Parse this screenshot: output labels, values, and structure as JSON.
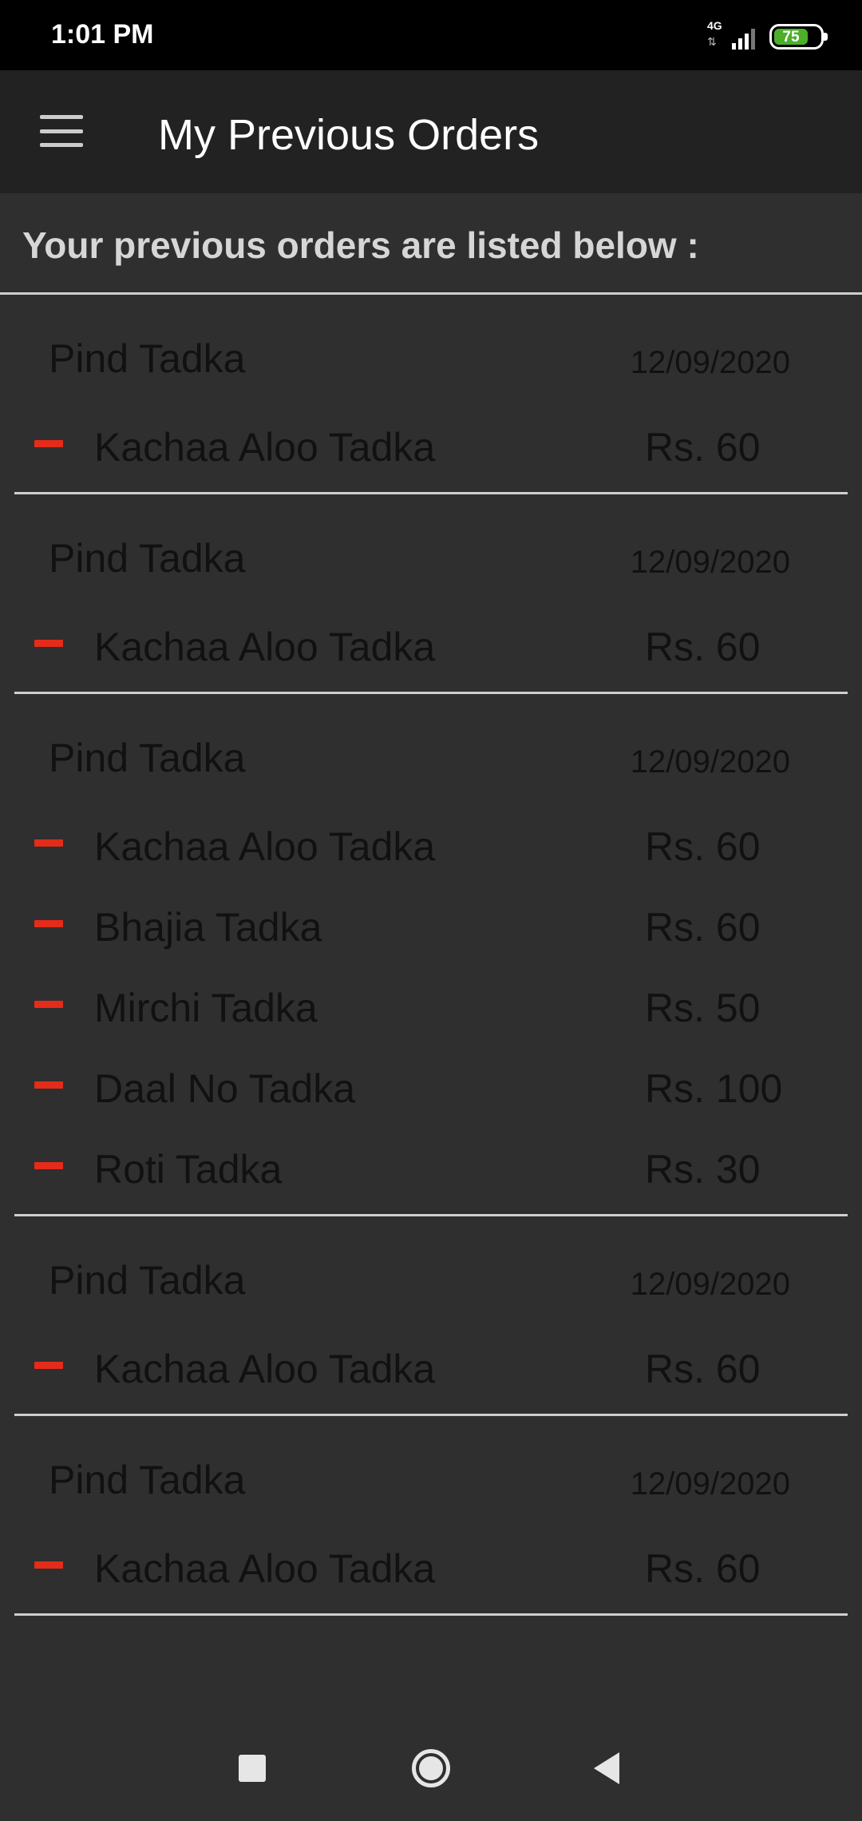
{
  "status_bar": {
    "time": "1:01 PM",
    "network": "4G",
    "battery": "75"
  },
  "app_bar": {
    "title": "My Previous Orders",
    "menu_icon": "hamburger-menu-icon"
  },
  "subtitle": "Your previous orders are listed below :",
  "colors": {
    "remove_icon": "#e52b1a",
    "app_bar": "#222222",
    "background": "#2f2f2f"
  },
  "orders": [
    {
      "restaurant": "Pind Tadka",
      "date": "12/09/2020",
      "items": [
        {
          "name": "Kachaa Aloo Tadka",
          "price": "Rs. 60"
        }
      ]
    },
    {
      "restaurant": "Pind Tadka",
      "date": "12/09/2020",
      "items": [
        {
          "name": "Kachaa Aloo Tadka",
          "price": "Rs. 60"
        }
      ]
    },
    {
      "restaurant": "Pind Tadka",
      "date": "12/09/2020",
      "items": [
        {
          "name": "Kachaa Aloo Tadka",
          "price": "Rs. 60"
        },
        {
          "name": "Bhajia Tadka",
          "price": "Rs. 60"
        },
        {
          "name": "Mirchi Tadka",
          "price": "Rs. 50"
        },
        {
          "name": "Daal No Tadka",
          "price": "Rs. 100"
        },
        {
          "name": "Roti Tadka",
          "price": "Rs. 30"
        }
      ]
    },
    {
      "restaurant": "Pind Tadka",
      "date": "12/09/2020",
      "items": [
        {
          "name": "Kachaa Aloo Tadka",
          "price": "Rs. 60"
        }
      ]
    },
    {
      "restaurant": "Pind Tadka",
      "date": "12/09/2020",
      "items": [
        {
          "name": "Kachaa Aloo Tadka",
          "price": "Rs. 60"
        }
      ]
    }
  ],
  "nav_bar": {
    "recents_icon": "recents-square-icon",
    "home_icon": "home-circle-icon",
    "back_icon": "back-triangle-icon"
  }
}
